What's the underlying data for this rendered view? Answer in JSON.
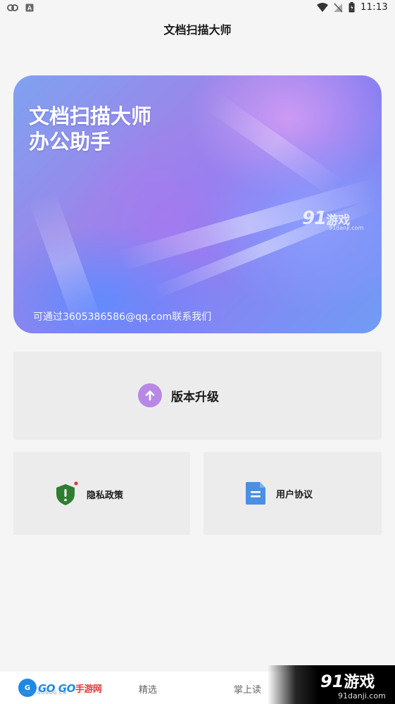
{
  "status_bar": {
    "time": "11:13"
  },
  "header": {
    "title": "文档扫描大师"
  },
  "banner": {
    "title_line1": "文档扫描大师",
    "title_line2": "办公助手",
    "contact": "可通过3605386586@qq.com联系我们",
    "watermark_logo": "91",
    "watermark_cn": "游戏",
    "watermark_site": "91danji.com"
  },
  "cards": {
    "upgrade_label": "版本升级",
    "privacy_label": "隐私政策",
    "agreement_label": "用户协议"
  },
  "bottom_nav": {
    "logo_badge": "G",
    "logo_text": "GO GO",
    "logo_cn": "手游网",
    "logo_sub": "WWW.GOGOO.CN",
    "items": [
      "精选",
      "掌上读"
    ],
    "watermark_logo": "91",
    "watermark_cn": "游戏",
    "watermark_site": "91danji.com"
  },
  "colors": {
    "upgrade_icon_bg": "#b888e6",
    "privacy_shield": "#2e7d32",
    "privacy_dot": "#e53935",
    "agreement_doc": "#4a90e2"
  }
}
